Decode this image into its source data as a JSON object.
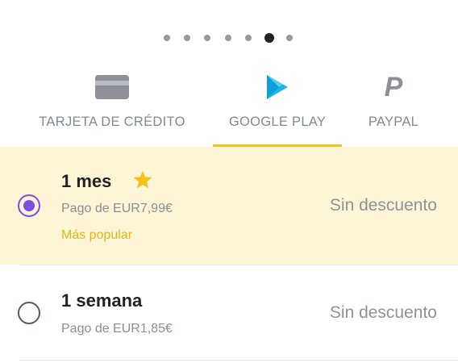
{
  "pager": {
    "count": 7,
    "active_index": 5
  },
  "tabs": [
    {
      "label": "TARJETA DE CRÉDITO",
      "icon": "credit-card-icon",
      "selected": false
    },
    {
      "label": "GOOGLE PLAY",
      "icon": "google-play-icon",
      "selected": true
    },
    {
      "label": "PAYPAL",
      "icon": "paypal-icon",
      "selected": false
    }
  ],
  "plans": [
    {
      "title": "1 mes",
      "price": "Pago de EUR7,99€",
      "badge": "Más popular",
      "discount": "Sin descuento",
      "selected": true,
      "icon": "star-icon"
    },
    {
      "title": "1 semana",
      "price": "Pago de EUR1,85€",
      "discount": "Sin descuento",
      "selected": false
    }
  ],
  "colors": {
    "accent_yellow": "#f5c21b",
    "selected_row_bg": "#fdf5d6",
    "radio_selected": "#7d4ee0",
    "popular_text": "#e7b416",
    "play_icon": "#1fb6e8"
  }
}
